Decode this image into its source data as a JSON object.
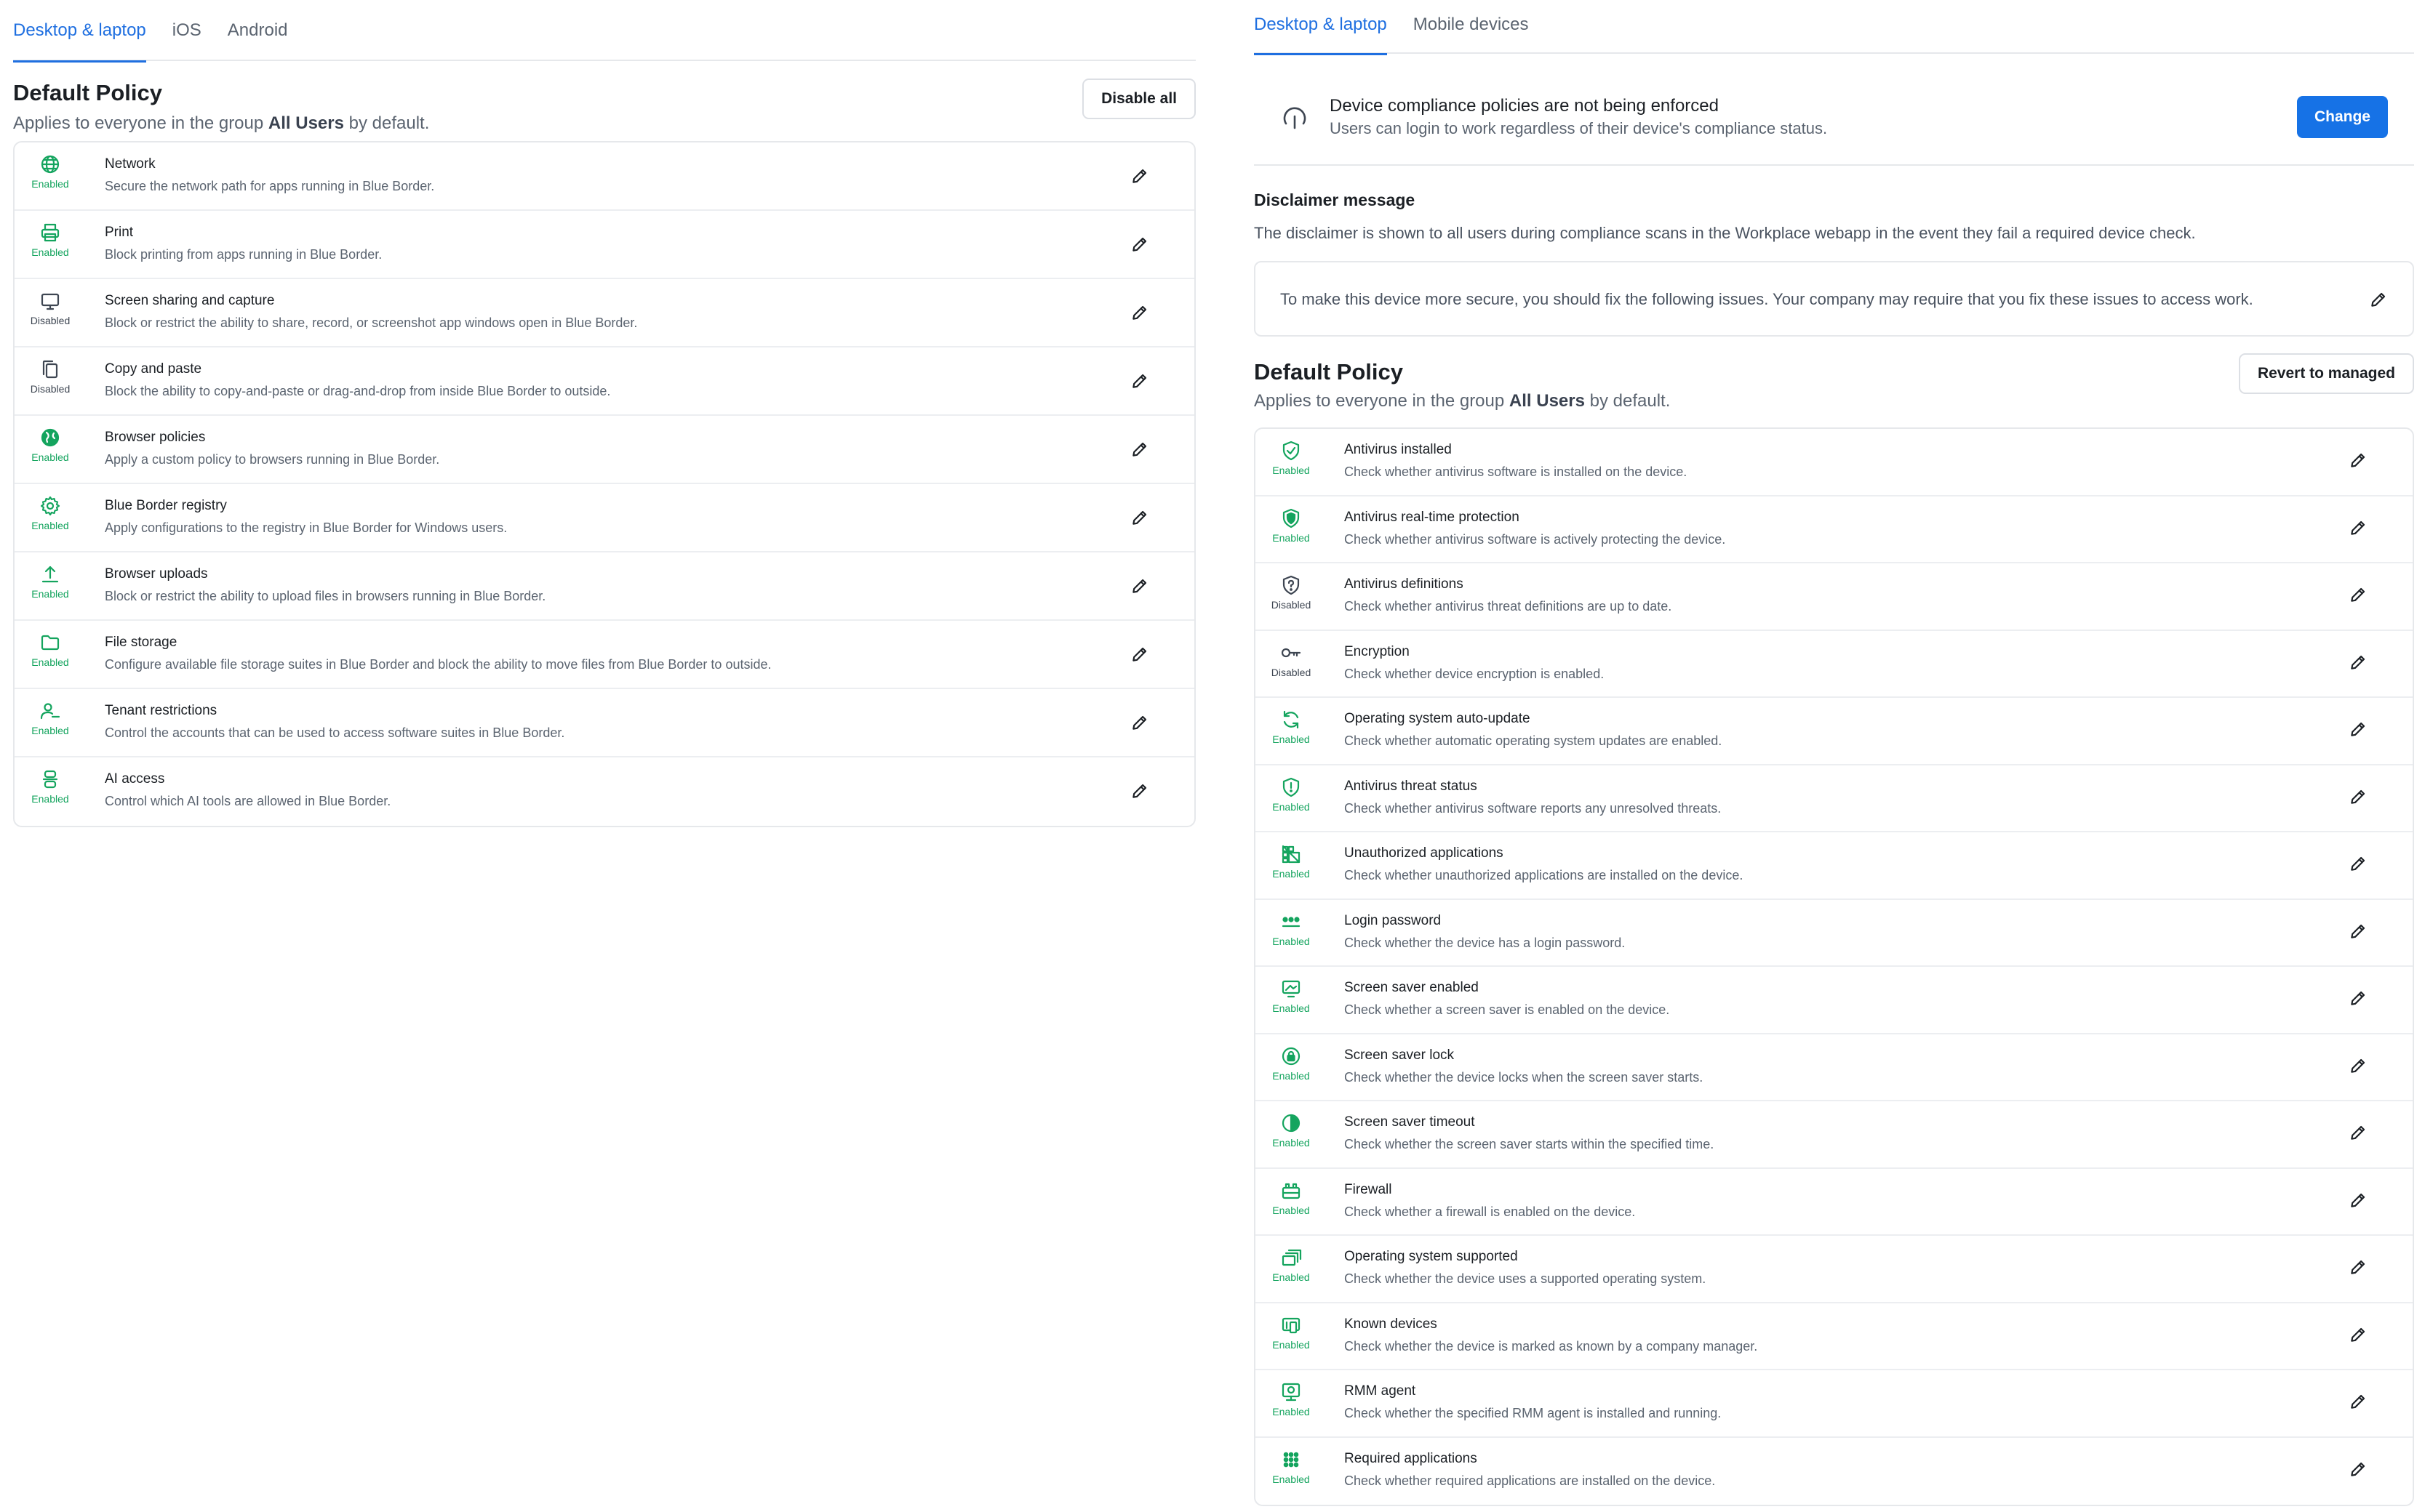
{
  "left": {
    "tabs": [
      {
        "label": "Desktop & laptop",
        "active": true
      },
      {
        "label": "iOS",
        "active": false
      },
      {
        "label": "Android",
        "active": false
      }
    ],
    "policy_title": "Default Policy",
    "policy_sub_prefix": "Applies to everyone in the group ",
    "policy_sub_group": "All Users",
    "policy_sub_suffix": " by default.",
    "action_label": "Disable all",
    "rows": [
      {
        "icon": "globe-icon",
        "status": "Enabled",
        "name": "Network",
        "desc": "Secure the network path for apps running in Blue Border."
      },
      {
        "icon": "printer-icon",
        "status": "Enabled",
        "name": "Print",
        "desc": "Block printing from apps running in Blue Border."
      },
      {
        "icon": "monitor-icon",
        "status": "Disabled",
        "name": "Screen sharing and capture",
        "desc": "Block or restrict the ability to share, record, or screenshot app windows open in Blue Border."
      },
      {
        "icon": "copy-icon",
        "status": "Disabled",
        "name": "Copy and paste",
        "desc": "Block the ability to copy-and-paste or drag-and-drop from inside Blue Border to outside."
      },
      {
        "icon": "globe-filled-icon",
        "status": "Enabled",
        "name": "Browser policies",
        "desc": "Apply a custom policy to browsers running in Blue Border."
      },
      {
        "icon": "gear-icon",
        "status": "Enabled",
        "name": "Blue Border registry",
        "desc": "Apply configurations to the registry in Blue Border for Windows users."
      },
      {
        "icon": "upload-icon",
        "status": "Enabled",
        "name": "Browser uploads",
        "desc": "Block or restrict the ability to upload files in browsers running in Blue Border."
      },
      {
        "icon": "folder-icon",
        "status": "Enabled",
        "name": "File storage",
        "desc": "Configure available file storage suites in Blue Border and block the ability to move files from Blue Border to outside."
      },
      {
        "icon": "user-restrict-icon",
        "status": "Enabled",
        "name": "Tenant restrictions",
        "desc": "Control the accounts that can be used to access software suites in Blue Border."
      },
      {
        "icon": "ai-icon",
        "status": "Enabled",
        "name": "AI access",
        "desc": "Control which AI tools are allowed in Blue Border."
      }
    ]
  },
  "right": {
    "tabs": [
      {
        "label": "Desktop & laptop",
        "active": true
      },
      {
        "label": "Mobile devices",
        "active": false
      }
    ],
    "notice": {
      "icon": "signal-off-icon",
      "title": "Device compliance policies are not being enforced",
      "sub": "Users can login to work regardless of their device's compliance status.",
      "button": "Change"
    },
    "disclaimer": {
      "title": "Disclaimer message",
      "desc": "The disclaimer is shown to all users during compliance scans in the Workplace webapp in the event they fail a required device check.",
      "text": "To make this device more secure, you should fix the following issues. Your company may require that you fix these issues to access work."
    },
    "policy_title": "Default  Policy",
    "policy_sub_prefix": "Applies to everyone in the group ",
    "policy_sub_group": "All Users",
    "policy_sub_suffix": " by default.",
    "action_label": "Revert to managed",
    "rows": [
      {
        "icon": "shield-check-icon",
        "status": "Enabled",
        "name": "Antivirus installed",
        "desc": "Check whether antivirus software is installed on the device."
      },
      {
        "icon": "shield-filled-icon",
        "status": "Enabled",
        "name": "Antivirus real-time protection",
        "desc": "Check whether antivirus software is actively protecting the device."
      },
      {
        "icon": "shield-question-icon",
        "status": "Disabled",
        "name": "Antivirus definitions",
        "desc": "Check whether antivirus threat definitions are up to date."
      },
      {
        "icon": "key-icon",
        "status": "Disabled",
        "name": "Encryption",
        "desc": "Check whether device encryption is enabled."
      },
      {
        "icon": "refresh-icon",
        "status": "Enabled",
        "name": "Operating system auto-update",
        "desc": "Check whether automatic operating system updates are enabled."
      },
      {
        "icon": "shield-alert-icon",
        "status": "Enabled",
        "name": "Antivirus threat status",
        "desc": "Check whether antivirus software reports any unresolved threats."
      },
      {
        "icon": "apps-blocked-icon",
        "status": "Enabled",
        "name": "Unauthorized applications",
        "desc": "Check whether unauthorized applications are installed on the device."
      },
      {
        "icon": "password-icon",
        "status": "Enabled",
        "name": "Login password",
        "desc": "Check whether the device has a login password."
      },
      {
        "icon": "screensaver-icon",
        "status": "Enabled",
        "name": "Screen saver enabled",
        "desc": "Check whether a screen saver is enabled on the device."
      },
      {
        "icon": "lock-circle-icon",
        "status": "Enabled",
        "name": "Screen saver lock",
        "desc": "Check whether the device locks when the screen saver starts."
      },
      {
        "icon": "timer-icon",
        "status": "Enabled",
        "name": "Screen saver timeout",
        "desc": "Check whether the screen saver starts within the specified time."
      },
      {
        "icon": "firewall-icon",
        "status": "Enabled",
        "name": "Firewall",
        "desc": "Check whether a firewall is enabled on the device."
      },
      {
        "icon": "windows-stack-icon",
        "status": "Enabled",
        "name": "Operating system supported",
        "desc": "Check whether the device uses a supported operating system."
      },
      {
        "icon": "devices-icon",
        "status": "Enabled",
        "name": "Known devices",
        "desc": "Check whether the device is marked as known by a company manager."
      },
      {
        "icon": "agent-icon",
        "status": "Enabled",
        "name": "RMM agent",
        "desc": "Check whether the specified RMM agent is installed and running."
      },
      {
        "icon": "grid-icon",
        "status": "Enabled",
        "name": "Required applications",
        "desc": "Check whether required applications are installed on the device."
      }
    ]
  },
  "colors": {
    "accent": "#1f6fe0",
    "primary_button": "#1672e6",
    "enabled": "#14a45e",
    "disabled": "#3e4652"
  }
}
